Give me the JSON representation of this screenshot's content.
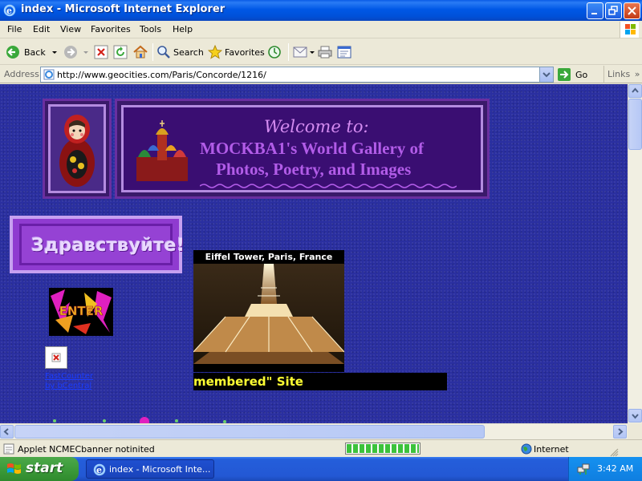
{
  "window": {
    "title": "index - Microsoft Internet Explorer",
    "minimize_icon": "minimize-icon",
    "maximize_icon": "maximize-icon",
    "close_icon": "close-icon"
  },
  "menu": {
    "items": [
      "File",
      "Edit",
      "View",
      "Favorites",
      "Tools",
      "Help"
    ]
  },
  "toolbar": {
    "back_label": "Back",
    "search_label": "Search",
    "favorites_label": "Favorites"
  },
  "address": {
    "label": "Address",
    "url": "http://www.geocities.com/Paris/Concorde/1216/",
    "go_label": "Go",
    "links_label": "Links"
  },
  "page": {
    "welcome": "Welcome to:",
    "gallery_line1": "MOCKBA1's World Gallery of",
    "gallery_line2": "Photos, Poetry, and Images",
    "greeting": "Здравствуйте!",
    "enter_label": "ENTER",
    "counter_link": "FastCounter by bCentral",
    "eiffel_caption": "Eiffel Tower, Paris, France",
    "marquee_text": "membered\" Site"
  },
  "status": {
    "text": "Applet NCMECbanner notinited",
    "zone": "Internet",
    "progress": 1.0
  },
  "taskbar": {
    "start_label": "start",
    "task_label": "index - Microsoft Inte...",
    "time": "3:42 AM"
  },
  "colors": {
    "page_background": "#2a2fa0",
    "banner_text": "#b25ce8",
    "marquee_text": "#ffff33"
  }
}
